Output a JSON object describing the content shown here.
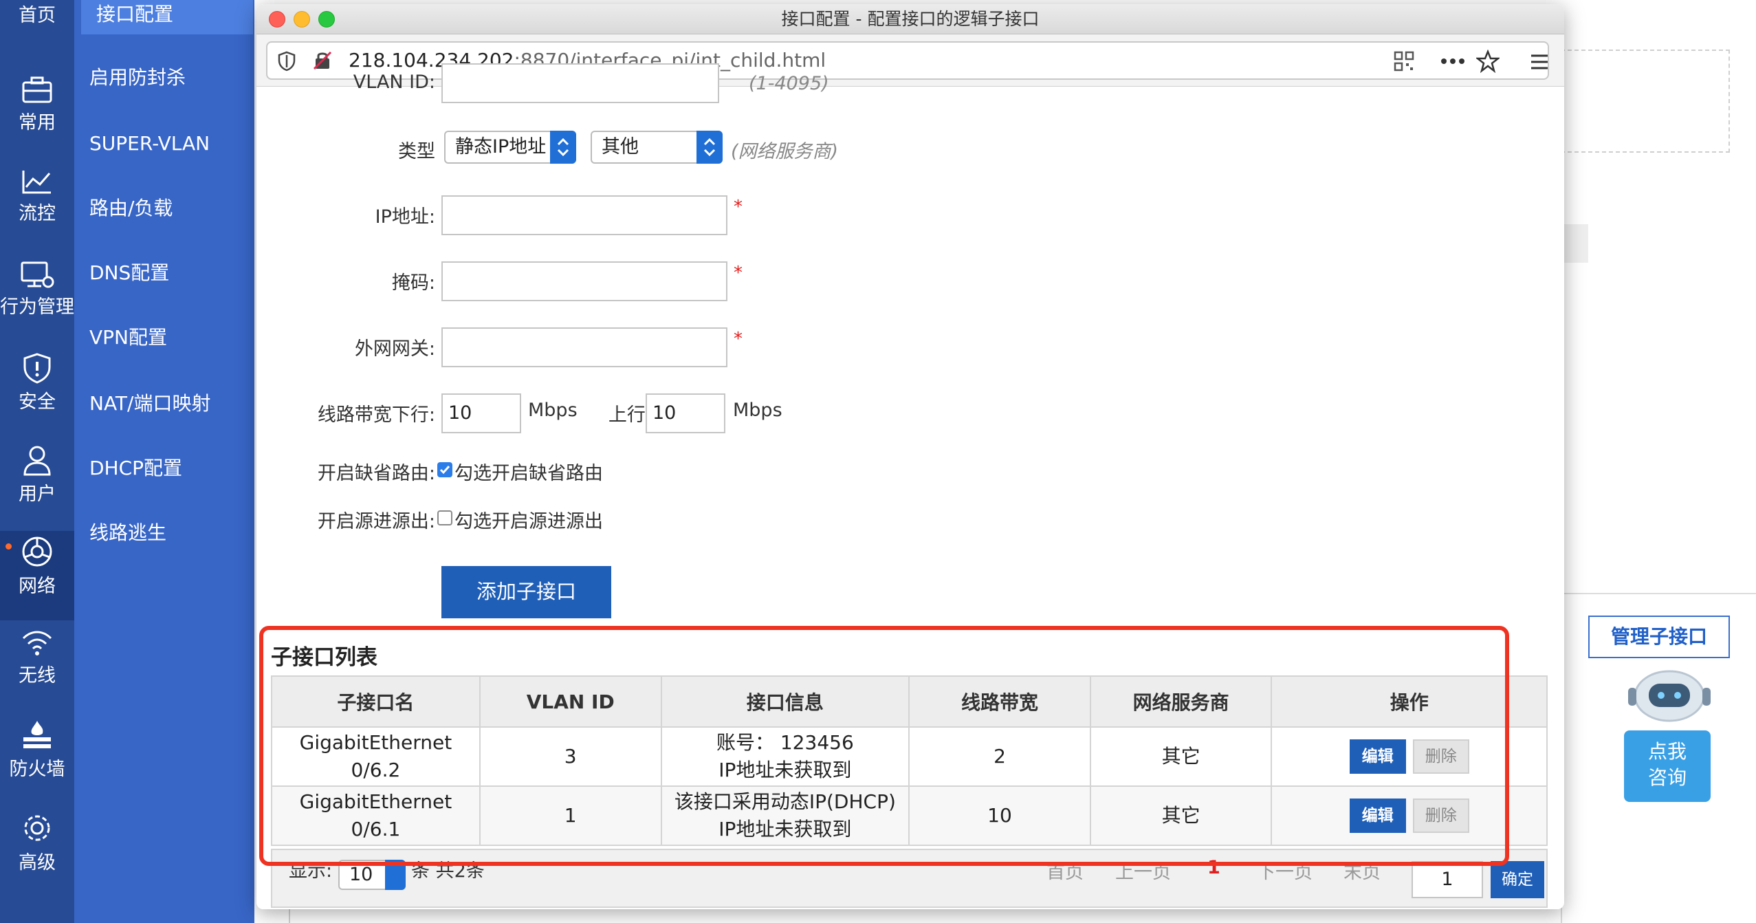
{
  "sidebar": {
    "items": [
      {
        "label": "首页",
        "icon": "home-icon"
      },
      {
        "label": "常用",
        "icon": "toolbox-icon"
      },
      {
        "label": "流控",
        "icon": "chart-icon"
      },
      {
        "label": "行为管理",
        "icon": "monitor-icon"
      },
      {
        "label": "安全",
        "icon": "shield-icon"
      },
      {
        "label": "用户",
        "icon": "user-icon"
      },
      {
        "label": "网络",
        "icon": "network-icon",
        "active": true
      },
      {
        "label": "无线",
        "icon": "wifi-icon"
      },
      {
        "label": "防火墙",
        "icon": "firewall-icon"
      },
      {
        "label": "高级",
        "icon": "gear-icon"
      }
    ]
  },
  "submenu": {
    "items": [
      "接口配置",
      "启用防封杀",
      "SUPER-VLAN",
      "路由/负载",
      "DNS配置",
      "VPN配置",
      "NAT/端口映射",
      "DHCP配置",
      "线路逃生"
    ]
  },
  "background": {
    "manage_button": "管理子接口",
    "consult_line1": "点我",
    "consult_line2": "咨询"
  },
  "window": {
    "title": "接口配置 - 配置接口的逻辑子接口",
    "url_host": "218.104.234.202",
    "url_rest": ":8870/interface_pi/int_child.html"
  },
  "form": {
    "vlan_label": "VLAN ID:",
    "vlan_hint": "(1-4095)",
    "type_label": "类型",
    "type_value": "静态IP地址",
    "isp_value": "其他",
    "isp_hint": "(网络服务商)",
    "ip_label": "IP地址:",
    "mask_label": "掩码:",
    "gateway_label": "外网网关:",
    "required_mark": "*",
    "bw_down_label": "线路带宽下行:",
    "bw_down_value": "10",
    "bw_unit": "Mbps",
    "bw_up_label": "上行:",
    "bw_up_value": "10",
    "default_route_label": "开启缺省路由:",
    "default_route_text": "勾选开启缺省路由",
    "default_route_checked": true,
    "src_route_label": "开启源进源出:",
    "src_route_text": "勾选开启源进源出",
    "src_route_checked": false,
    "add_button": "添加子接口"
  },
  "list": {
    "title": "子接口列表",
    "columns": [
      "子接口名",
      "VLAN ID",
      "接口信息",
      "线路带宽",
      "网络服务商",
      "操作"
    ],
    "rows": [
      {
        "name": "GigabitEthernet 0/6.2",
        "vlan": "3",
        "info1": "账号： 123456",
        "info2": "IP地址未获取到",
        "bandwidth": "2",
        "isp": "其它",
        "edit": "编辑",
        "delete": "删除"
      },
      {
        "name": "GigabitEthernet 0/6.1",
        "vlan": "1",
        "info1": "该接口采用动态IP(DHCP)",
        "info2": "IP地址未获取到",
        "bandwidth": "10",
        "isp": "其它",
        "edit": "编辑",
        "delete": "删除"
      }
    ]
  },
  "pager": {
    "show_label": "显示:",
    "page_size": "10",
    "count_text": "条 共2条",
    "first": "首页",
    "prev": "上一页",
    "current": "1",
    "next": "下一页",
    "last": "末页",
    "goto_value": "1",
    "confirm": "确定"
  },
  "colors": {
    "sidebar": "#274b94",
    "submenu": "#3866c7",
    "primary_button": "#1f5fb8",
    "highlight_frame": "#ee3322"
  }
}
